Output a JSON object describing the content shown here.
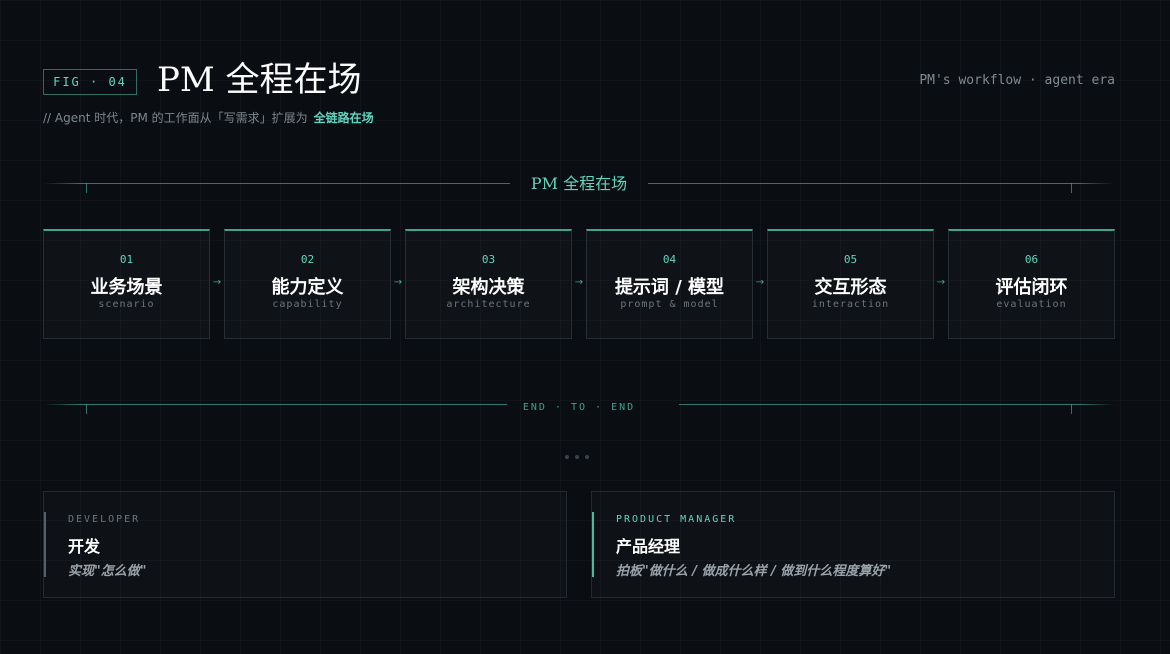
{
  "header": {
    "fig_label": "FIG · 04",
    "title": "PM 全程在场",
    "subtitle_prefix": "// Agent 时代，PM 的工作面从「写需求」扩展为",
    "subtitle_highlight": "全链路在场",
    "top_right": "PM's workflow · agent era"
  },
  "section_top": {
    "label": "PM 全程在场"
  },
  "steps": [
    {
      "num": "01",
      "zh": "业务场景",
      "en": "scenario"
    },
    {
      "num": "02",
      "zh": "能力定义",
      "en": "capability"
    },
    {
      "num": "03",
      "zh": "架构决策",
      "en": "architecture"
    },
    {
      "num": "04",
      "zh": "提示词 / 模型",
      "en": "prompt & model"
    },
    {
      "num": "05",
      "zh": "交互形态",
      "en": "interaction"
    },
    {
      "num": "06",
      "zh": "评估闭环",
      "en": "evaluation"
    }
  ],
  "arrow_glyph": "→",
  "section_bottom": {
    "label": "END · TO · END"
  },
  "cards": {
    "developer": {
      "role": "DEVELOPER",
      "title": "开发",
      "desc": "实现\"怎么做\""
    },
    "pm": {
      "role": "PRODUCT MANAGER",
      "title": "产品经理",
      "desc": "拍板\"做什么 / 做成什么样 / 做到什么程度算好\""
    }
  },
  "colors": {
    "accent": "#5fd6bd",
    "accent_line": "#3fa48a",
    "background": "#0a0d11",
    "muted_bar": "#56616a"
  }
}
